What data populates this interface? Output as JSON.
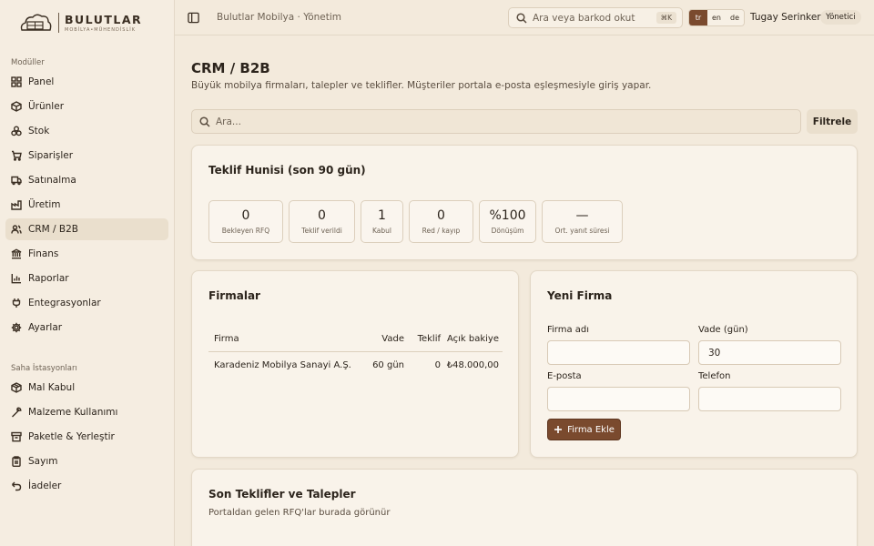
{
  "brand": {
    "name": "BULUTLAR",
    "tagline": "MOBİLYA•MÜHENDİSLİK"
  },
  "sidebar": {
    "section_modules": "Modüller",
    "modules": [
      {
        "label": "Panel",
        "icon": "grid-icon"
      },
      {
        "label": "Ürünler",
        "icon": "box-icon"
      },
      {
        "label": "Stok",
        "icon": "boxes-icon"
      },
      {
        "label": "Siparişler",
        "icon": "cart-icon"
      },
      {
        "label": "Satınalma",
        "icon": "truck-icon"
      },
      {
        "label": "Üretim",
        "icon": "factory-icon"
      },
      {
        "label": "CRM / B2B",
        "icon": "users-icon",
        "active": true
      },
      {
        "label": "Finans",
        "icon": "bank-icon"
      },
      {
        "label": "Raporlar",
        "icon": "chart-icon"
      },
      {
        "label": "Entegrasyonlar",
        "icon": "plug-icon"
      },
      {
        "label": "Ayarlar",
        "icon": "gear-icon"
      }
    ],
    "section_stations": "Saha İstasyonları",
    "stations": [
      {
        "label": "Mal Kabul",
        "icon": "package-icon"
      },
      {
        "label": "Malzeme Kullanımı",
        "icon": "wrench-icon"
      },
      {
        "label": "Paketle & Yerleştir",
        "icon": "archive-icon"
      },
      {
        "label": "Sayım",
        "icon": "clipboard-icon"
      },
      {
        "label": "İadeler",
        "icon": "undo-icon"
      }
    ]
  },
  "topbar": {
    "breadcrumb": "Bulutlar Mobilya · Yönetim",
    "search_placeholder": "Ara veya barkod okut",
    "shortcut": "⌘K",
    "languages": [
      "tr",
      "en",
      "de"
    ],
    "active_language": "tr",
    "user_name": "Tugay Serinken",
    "role": "Yönetici"
  },
  "page": {
    "title": "CRM / B2B",
    "subtitle": "Büyük mobilya firmaları, talepler ve teklifler. Müşteriler portala e-posta eşleşmesiyle giriş yapar.",
    "search_placeholder": "Ara...",
    "filter_label": "Filtrele"
  },
  "funnel": {
    "title": "Teklif Hunisi (son 90 gün)",
    "stats": [
      {
        "value": "0",
        "label": "Bekleyen RFQ"
      },
      {
        "value": "0",
        "label": "Teklif verildi"
      },
      {
        "value": "1",
        "label": "Kabul"
      },
      {
        "value": "0",
        "label": "Red / kayıp"
      },
      {
        "value": "%100",
        "label": "Dönüşüm"
      },
      {
        "value": "—",
        "label": "Ort. yanıt süresi"
      }
    ]
  },
  "companies": {
    "title": "Firmalar",
    "columns": [
      "Firma",
      "Vade",
      "Teklif",
      "Açık bakiye"
    ],
    "rows": [
      [
        "Karadeniz Mobilya Sanayi A.Ş.",
        "60 gün",
        "0",
        "₺48.000,00"
      ]
    ]
  },
  "new_firm": {
    "title": "Yeni Firma",
    "name_label": "Firma adı",
    "name_value": "",
    "term_label": "Vade (gün)",
    "term_value": "30",
    "email_label": "E-posta",
    "email_value": "",
    "phone_label": "Telefon",
    "phone_value": "",
    "submit_label": "Firma Ekle"
  },
  "recent": {
    "title": "Son Teklifler ve Talepler",
    "subtitle": "Portaldan gelen RFQ'lar burada görünür"
  },
  "colors": {
    "accent": "#7a4a2e",
    "background": "#f3eadc",
    "card": "#f9f3ea",
    "active_nav": "#eadfcd"
  }
}
